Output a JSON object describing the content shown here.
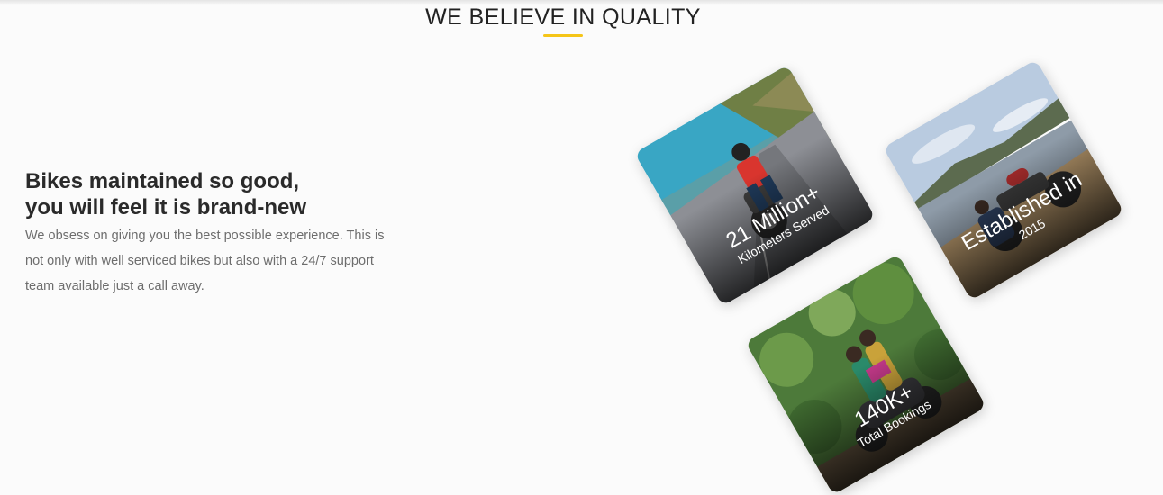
{
  "section": {
    "title": "WE BELIEVE IN QUALITY"
  },
  "intro": {
    "headline_line1": "Bikes maintained so good,",
    "headline_line2": "you will feel it is brand-new",
    "body": "We obsess on giving you the best possible experience. This is not only with well serviced bikes but also with a 24/7 support team available just a call away."
  },
  "stats": [
    {
      "value": "21 Million+",
      "label": "Kilometers Served"
    },
    {
      "value": "Established in",
      "label": "2015"
    },
    {
      "value": "140K+",
      "label": "Total Bookings"
    }
  ],
  "colors": {
    "accent": "#f5c518",
    "background": "#fbfbfb",
    "heading": "#2a2a2a",
    "body_text": "#6d6d6d"
  }
}
